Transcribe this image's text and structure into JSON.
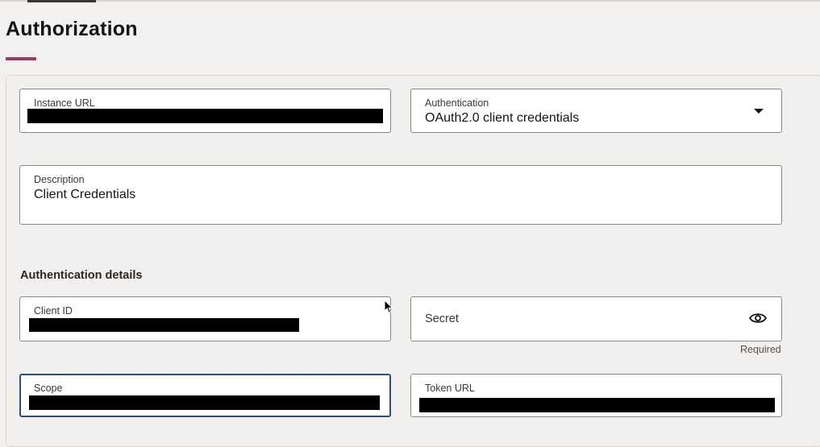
{
  "page": {
    "title": "Authorization"
  },
  "fields": {
    "instance_url": {
      "label": "Instance URL",
      "value": ""
    },
    "authentication": {
      "label": "Authentication",
      "value": "OAuth2.0 client credentials"
    },
    "description": {
      "label": "Description",
      "value": "Client Credentials"
    },
    "client_id": {
      "label": "Client ID",
      "value": ""
    },
    "secret": {
      "label": "Secret",
      "value": "",
      "helper": "Required"
    },
    "scope": {
      "label": "Scope",
      "value": ""
    },
    "token_url": {
      "label": "Token URL",
      "value": ""
    }
  },
  "sections": {
    "auth_details": "Authentication details"
  },
  "icons": {
    "dropdown": "chevron-down-icon",
    "reveal": "eye-icon",
    "pointer": "mouse-cursor-icon"
  },
  "colors": {
    "accent": "#9e3a5a",
    "focus": "#2b4f7a",
    "background": "#f2f1ef"
  }
}
